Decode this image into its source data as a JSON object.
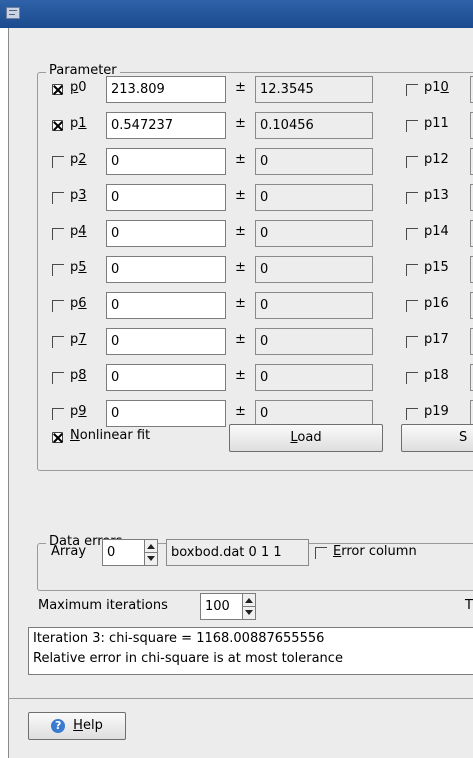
{
  "parameter_group": {
    "title": "Parameter",
    "rows": [
      {
        "label": "p0",
        "mnemonic": "p",
        "rest": "0",
        "checked": true,
        "value": "213.809",
        "error": "12.3545"
      },
      {
        "label": "p1",
        "mnemonic": "1",
        "rest": "",
        "prefix": "p",
        "checked": true,
        "value": "0.547237",
        "error": "0.10456"
      },
      {
        "label": "p2",
        "prefix": "p",
        "mnemonic": "2",
        "checked": false,
        "value": "0",
        "error": "0"
      },
      {
        "label": "p3",
        "prefix": "p",
        "mnemonic": "3",
        "checked": false,
        "value": "0",
        "error": "0"
      },
      {
        "label": "p4",
        "prefix": "p",
        "mnemonic": "4",
        "checked": false,
        "value": "0",
        "error": "0"
      },
      {
        "label": "p5",
        "prefix": "p",
        "mnemonic": "5",
        "checked": false,
        "value": "0",
        "error": "0"
      },
      {
        "label": "p6",
        "prefix": "p",
        "mnemonic": "6",
        "checked": false,
        "value": "0",
        "error": "0"
      },
      {
        "label": "p7",
        "prefix": "p",
        "mnemonic": "7",
        "checked": false,
        "value": "0",
        "error": "0"
      },
      {
        "label": "p8",
        "prefix": "p",
        "mnemonic": "8",
        "checked": false,
        "value": "0",
        "error": "0"
      },
      {
        "label": "p9",
        "prefix": "p",
        "mnemonic": "9",
        "checked": false,
        "value": "0",
        "error": "0"
      }
    ],
    "plus_minus": "±",
    "right_column": [
      {
        "prefix": "p1",
        "mnemonic": "0",
        "checked": false
      },
      {
        "prefix": "p11",
        "mnemonic": "",
        "checked": false
      },
      {
        "prefix": "p12",
        "mnemonic": "",
        "checked": false
      },
      {
        "prefix": "p13",
        "mnemonic": "",
        "checked": false
      },
      {
        "prefix": "p14",
        "mnemonic": "",
        "checked": false
      },
      {
        "prefix": "p15",
        "mnemonic": "",
        "checked": false
      },
      {
        "prefix": "p16",
        "mnemonic": "",
        "checked": false
      },
      {
        "prefix": "p17",
        "mnemonic": "",
        "checked": false
      },
      {
        "prefix": "p18",
        "mnemonic": "",
        "checked": false
      },
      {
        "prefix": "p19",
        "mnemonic": "",
        "checked": false
      }
    ],
    "nonlinear_fit": {
      "mnemonic": "N",
      "rest": "onlinear fit",
      "checked": true
    },
    "load_button": {
      "mnemonic": "L",
      "rest": "oad"
    },
    "save_button_partial": "S"
  },
  "data_errors": {
    "title": "Data errors",
    "array_label": "Array",
    "array_value": "0",
    "dataset": "boxbod.dat 0 1 1",
    "error_column": {
      "mnemonic": "E",
      "rest": "rror column",
      "checked": false
    }
  },
  "max_iterations": {
    "label": "Maximum iterations",
    "value": "100",
    "partial_right": "T"
  },
  "log_lines": [
    "Iteration   3:   chi-square = 1168.00887655556",
    "Relative error in chi-square is at most tolerance"
  ],
  "help_button": {
    "mnemonic": "H",
    "rest": "elp"
  }
}
